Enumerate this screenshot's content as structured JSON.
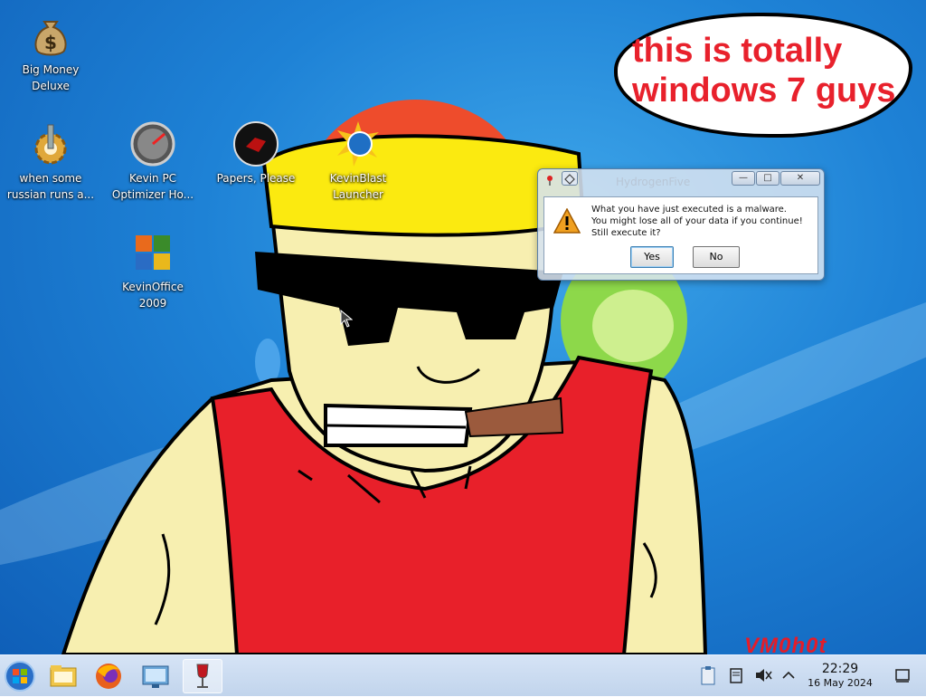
{
  "desktop": {
    "icons": [
      {
        "label": "Big Money\nDeluxe",
        "icon": "money-bag-icon"
      },
      {
        "label": "when some\nrussian runs a...",
        "icon": "gear-icon"
      },
      {
        "label": "Kevin PC\nOptimizer Ho...",
        "icon": "speedometer-icon"
      },
      {
        "label": "Papers, Please",
        "icon": "papers-please-icon"
      },
      {
        "label": "KevinBlast\nLauncher",
        "icon": "blast-launcher-icon"
      },
      {
        "label": "KevinOffice\n2009",
        "icon": "office-icon"
      }
    ]
  },
  "bubble": {
    "text": "this is totally windows 7 guys"
  },
  "watermark": {
    "text": "VM0h0t"
  },
  "dialog": {
    "title": "HydrogenFive",
    "message_lines": [
      "What you have just executed is a malware.",
      "You might lose all of your data if you continue!",
      "Still execute it?"
    ],
    "yes_label": "Yes",
    "no_label": "No",
    "minimize_glyph": "—",
    "maximize_glyph": "□",
    "close_glyph": "✕"
  },
  "taskbar": {
    "items": [
      "start-orb-icon",
      "file-explorer-icon",
      "firefox-icon",
      "control-panel-icon",
      "wine-glass-icon"
    ],
    "tray": [
      "clipboard-icon",
      "storage-icon",
      "muted-speaker-icon",
      "chevron-up-icon",
      "show-desktop-icon"
    ],
    "time": "22:29",
    "date": "16 May 2024"
  },
  "colors": {
    "bubble_text": "#e8212c",
    "dialog_border": "#5a7fa8",
    "taskbar": "#c9dcf2"
  }
}
